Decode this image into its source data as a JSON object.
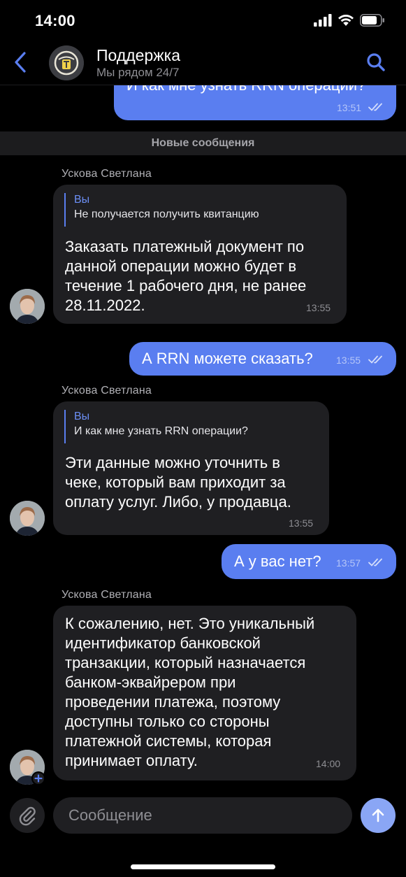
{
  "status": {
    "time": "14:00"
  },
  "header": {
    "title": "Поддержка",
    "subtitle": "Мы рядом 24/7"
  },
  "divider": {
    "label": "Новые сообщения"
  },
  "messages": [
    {
      "dir": "out",
      "text": "И как мне узнать RRN операции?",
      "time": "13:51"
    },
    {
      "dir": "in",
      "sender": "Ускова Светлана",
      "quote_author": "Вы",
      "quote_text": "Не получается получить квитанцию",
      "lines": [
        "Заказать платежный документ по",
        "данной операции можно будет в",
        "течение 1 рабочего дня, не ранее",
        "28.11.2022."
      ],
      "time": "13:55"
    },
    {
      "dir": "out",
      "text": "А RRN можете сказать?",
      "time": "13:55"
    },
    {
      "dir": "in",
      "sender": "Ускова Светлана",
      "quote_author": "Вы",
      "quote_text": "И как мне узнать RRN операции?",
      "lines": [
        "Эти данные можно уточнить в",
        "чеке, который вам приходит за",
        "оплату услуг. Либо, у продавца."
      ],
      "time": "13:55"
    },
    {
      "dir": "out",
      "text": "А у вас нет?",
      "time": "13:57"
    },
    {
      "dir": "in",
      "sender": "Ускова Светлана",
      "lines": [
        "К сожалению, нет. Это уникальный",
        "идентификатор банковской",
        "транзакции, который назначается",
        "банком-эквайрером при",
        "проведении платежа, поэтому",
        "доступны только со стороны",
        "платежной системы, которая",
        "принимает оплату."
      ],
      "time": "14:00"
    }
  ],
  "input": {
    "placeholder": "Сообщение"
  },
  "icons": {
    "back": "chevron-left-icon",
    "search": "search-icon",
    "attach": "paperclip-icon",
    "send": "arrow-up-icon",
    "read": "double-check-icon"
  },
  "colors": {
    "accent": "#5a7ef0",
    "incoming": "#1f1f22",
    "background": "#000000",
    "send": "#8aa6f5"
  }
}
